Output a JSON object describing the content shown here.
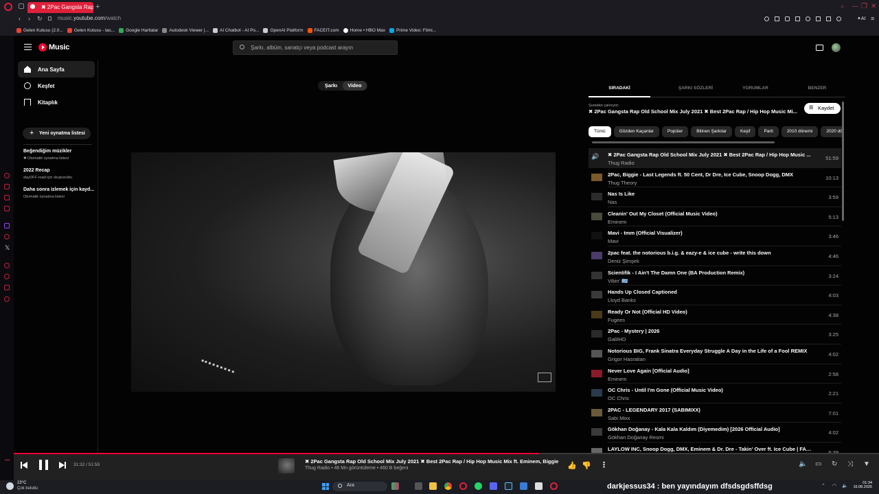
{
  "browser": {
    "tab_title": "✖ 2Pac Gangsta Rap O",
    "address_prefix": "music.",
    "address_domain": "youtube.com",
    "address_path": "/watch",
    "bookmarks": [
      {
        "label": "Gelen Kutusu (2.0...",
        "color": "#ea4335"
      },
      {
        "label": "Gelen Kutusu - tas...",
        "color": "#ea4335"
      },
      {
        "label": "Google Haritalar",
        "color": "#34a853"
      },
      {
        "label": "Autodesk Viewer |...",
        "color": "#888888"
      },
      {
        "label": "AI Chatbot - AI Po...",
        "color": "#cccccc"
      },
      {
        "label": "OpenAI Platform",
        "color": "#cccccc"
      },
      {
        "label": "FACEIT.com",
        "color": "#ff5500"
      },
      {
        "label": "Home • HBO Max",
        "color": "#ffffff"
      },
      {
        "label": "Prime Video: Filmi...",
        "color": "#00a8e1"
      }
    ]
  },
  "header": {
    "logo": "Music",
    "search_placeholder": "Şarkı, albüm, sanatçı veya podcast arayın"
  },
  "nav": {
    "items": [
      {
        "label": "Ana Sayfa"
      },
      {
        "label": "Keşfet"
      },
      {
        "label": "Kitaplık"
      }
    ],
    "new_playlist": "Yeni oynatma listesi",
    "playlists": [
      {
        "title": "Beğendiğim müzikler",
        "subtitle": "✱ Otomatik oynatma listesi"
      },
      {
        "title": "2022 Recap",
        "subtitle": "dayOFF-road için oluşturuldu"
      },
      {
        "title": "Daha sonra izlemek için kayd...",
        "subtitle": "Otomatik oynatma listesi"
      }
    ]
  },
  "player_toggle": {
    "song": "Şarkı",
    "video": "Video"
  },
  "right_panel": {
    "tabs": [
      "SIRADAKİ",
      "ŞARKI SÖZLERİ",
      "YORUMLAR",
      "BENZER"
    ],
    "playing_from_label": "Şuradan çalınıyor:",
    "playing_from_title": "✖ 2Pac Gangsta Rap Old School Mix July 2021 ✖ Best 2Pac Rap / Hip Hop Music Mi...",
    "save_label": "Kaydet",
    "chips": [
      "Tümü",
      "Gözden Kaçanlar",
      "Popüler",
      "Bilinen Şarkılar",
      "Keşif",
      "Parti",
      "2010 dönemi",
      "2020 dö"
    ],
    "queue": [
      {
        "title": "✖ 2Pac Gangsta Rap Old School Mix July 2021 ✖ Best 2Pac Rap / Hip Hop Music ...",
        "artist": "Thug Radio",
        "duration": "51:59"
      },
      {
        "title": "2Pac, Biggie - Last Legends ft. 50 Cent, Dr Dre, Ice Cube, Snoop Dogg, DMX",
        "artist": "Thug Theory",
        "duration": "10:13"
      },
      {
        "title": "Nas Is Like",
        "artist": "Nas",
        "duration": "3:59"
      },
      {
        "title": "Cleanin' Out My Closet (Official Music Video)",
        "artist": "Eminem",
        "duration": "5:13"
      },
      {
        "title": "Mavi - tmm (Official Visualizer)",
        "artist": "Mavi",
        "duration": "3:46"
      },
      {
        "title": "2pac feat. the notorious b.i.g. & eazy-e & ice cube - write this down",
        "artist": "Deniz Şimşek",
        "duration": "4:46"
      },
      {
        "title": "Scientifik - I Ain't The Damn One (BA Production Remix)",
        "artist": "Vibin' 🇬🇷",
        "duration": "3:24"
      },
      {
        "title": "Hands Up Closed Captioned",
        "artist": "Lloyd Banks",
        "duration": "4:03"
      },
      {
        "title": "Ready Or Not (Official HD Video)",
        "artist": "Fugees",
        "duration": "4:38"
      },
      {
        "title": "2Pac - Mystery | 2026",
        "artist": "GaliIHD",
        "duration": "3:25"
      },
      {
        "title": "Notorious BIG, Frank Sinatra Everyday Struggle A Day in the Life of a Fool REMIX",
        "artist": "Grigor Hasratian",
        "duration": "4:02"
      },
      {
        "title": "Never Love Again [Official Audio]",
        "artist": "Eminem",
        "duration": "2:58"
      },
      {
        "title": "OC Chris - Until I'm Gone (Official Music Video)",
        "artist": "OC Chris",
        "duration": "2:21"
      },
      {
        "title": "2PAC - LEGENDARY 2017 (SABIMIXX)",
        "artist": "Sabi Mixx",
        "duration": "7:01"
      },
      {
        "title": "Gökhan Doğanay - Kala Kala Kaldım (Diyemedim) [2026 Official Audio]",
        "artist": "Gökhan Doğanay Resmi",
        "duration": "4:02"
      },
      {
        "title": "LAYLOW INC, Snoop Dogg, DMX, Eminem & Dr. Dre - Takin' Over ft. Ice Cube | FAST A...",
        "artist": "",
        "duration": "6:39"
      }
    ]
  },
  "player_bar": {
    "time": "31:32 / 51:59",
    "progress": 0.607,
    "title": "✖ 2Pac Gangsta Rap Old School Mix July 2021 ✖ Best 2Pac Rap / Hip Hop Music Mix ft. Eminem, Biggie",
    "meta": "Thug Radio • 46 Mn görüntüleme • 460 B beğeni"
  },
  "taskbar": {
    "temp": "23°C",
    "weather": "Çok bulutlu",
    "search": "Ara",
    "overlay_message": "darkjessus34 : ben yayındayım dfsdsgdsffdsg",
    "time": "01:34",
    "date": "16.08.2026"
  },
  "colors": {
    "accent": "#ff0033",
    "opera": "#e0203a"
  }
}
